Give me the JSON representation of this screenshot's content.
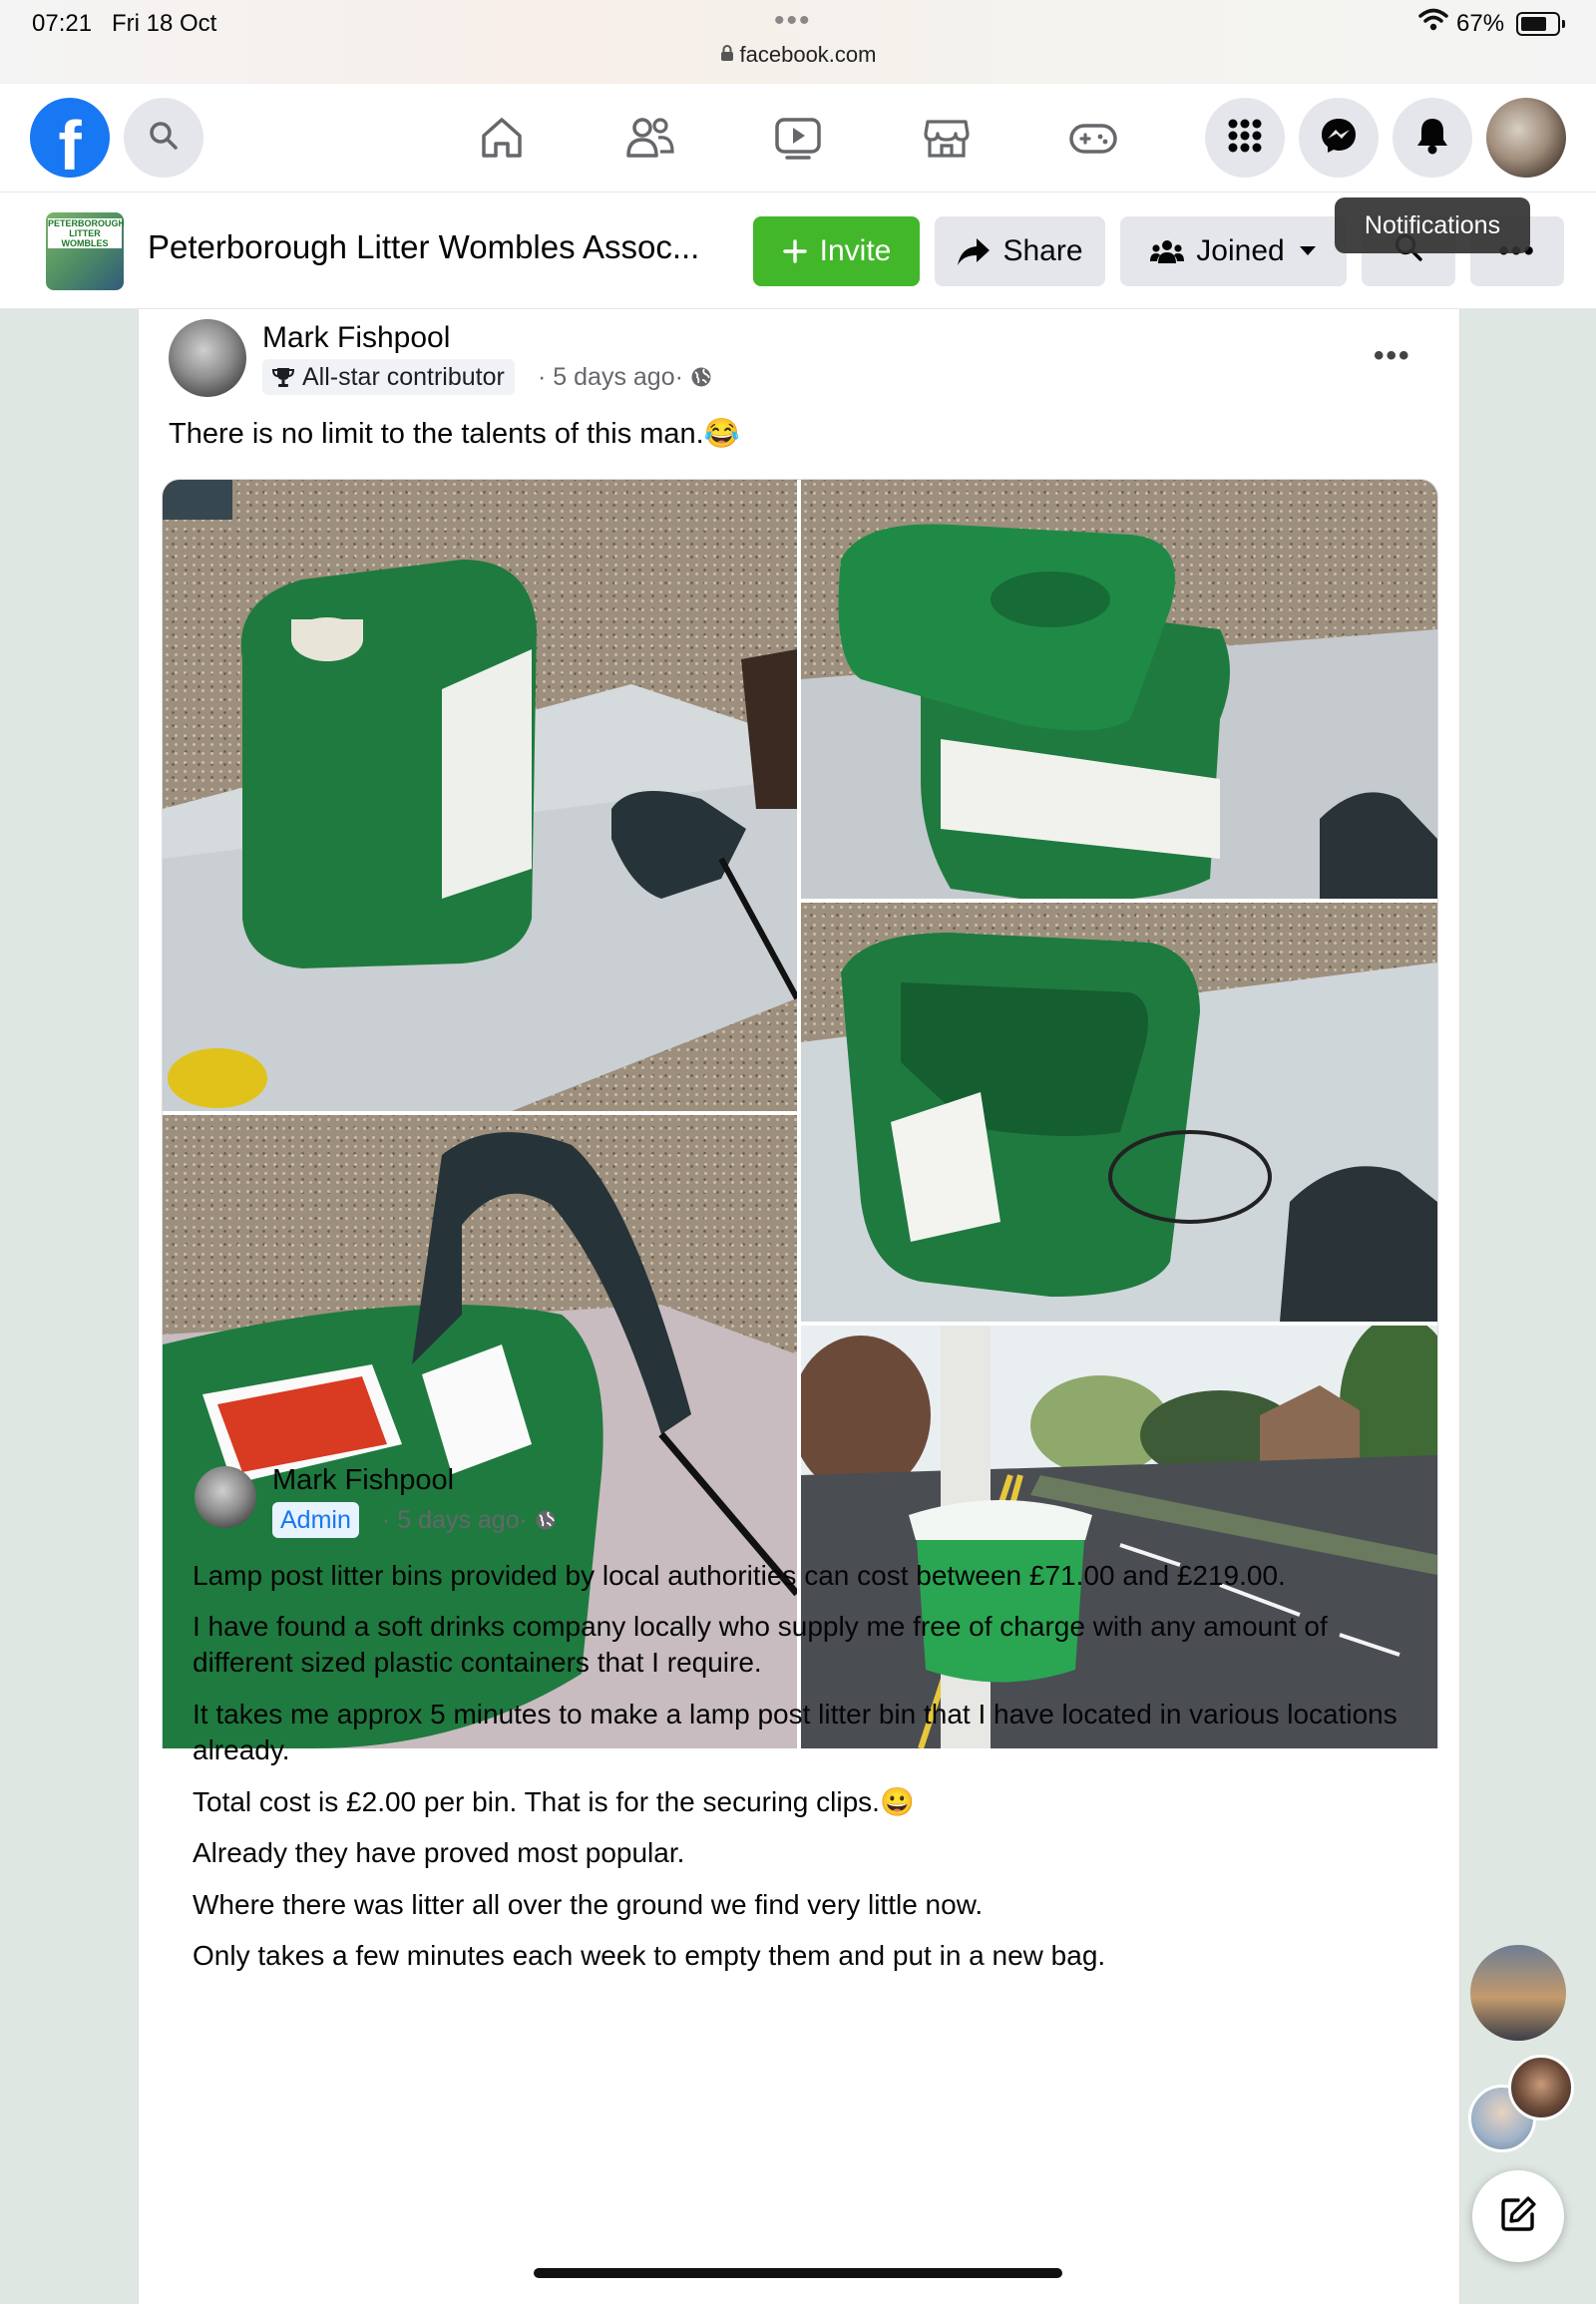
{
  "status_bar": {
    "time": "07:21",
    "date": "Fri 18 Oct",
    "url": "facebook.com",
    "battery": "67%"
  },
  "nav": {
    "icons": [
      "facebook-logo",
      "search-icon",
      "home-icon",
      "friends-icon",
      "watch-icon",
      "marketplace-icon",
      "gaming-icon",
      "menu-grid-icon",
      "messenger-icon",
      "bell-icon",
      "avatar"
    ]
  },
  "group": {
    "thumb_text": "PETERBOROUGH LITTER WOMBLES",
    "name": "Peterborough Litter Wombles Assoc...",
    "invite": "Invite",
    "share": "Share",
    "joined": "Joined"
  },
  "tooltip": "Notifications",
  "post": {
    "author": "Mark Fishpool",
    "badge": "All-star contributor",
    "time": "5 days ago",
    "text": "There is no limit to the talents of this man.😂"
  },
  "comment": {
    "author": "Mark Fishpool",
    "role": "Admin",
    "time": "5 days ago",
    "paragraphs": [
      "Lamp post litter bins provided by local authorities can cost between £71.00 and £219.00.",
      "I have found a  soft drinks company  locally who supply me free of charge with any amount of  different sized plastic containers that I require.",
      "It takes me approx 5 minutes to make a lamp post litter bin that I have located in various locations already.",
      "Total  cost is £2.00 per bin. That is for the securing clips.😀",
      "Already they have proved most popular.",
      "Where there was litter all over the ground we find very little now.",
      "Only takes a few minutes each week to empty them and put in a new bag."
    ]
  },
  "colors": {
    "facebook_blue": "#1877f2",
    "invite_green": "#42b72a",
    "container_green": "#1f7a3f"
  }
}
